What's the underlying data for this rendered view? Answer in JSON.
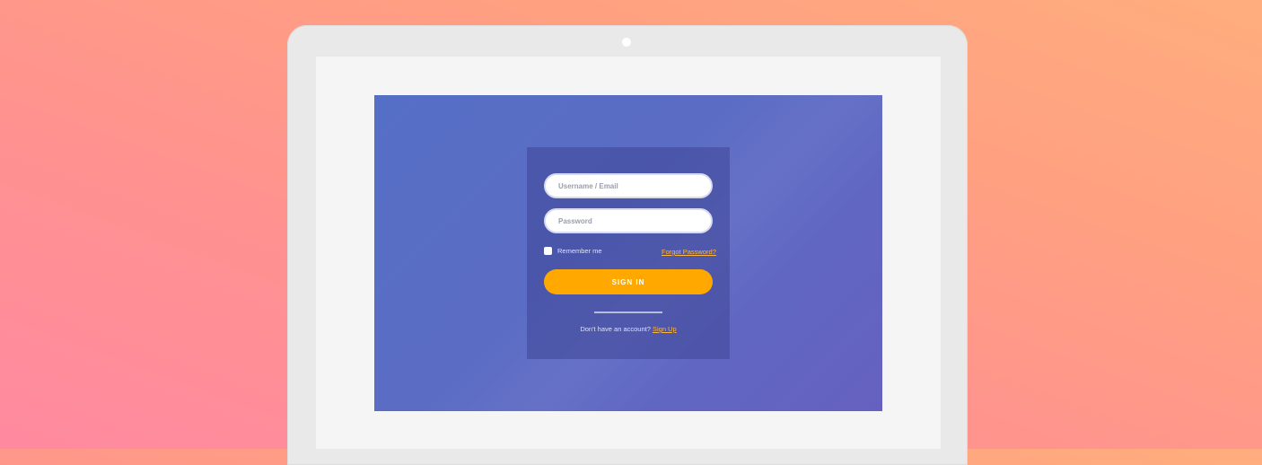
{
  "login": {
    "username_placeholder": "Username / Email",
    "password_placeholder": "Password",
    "remember_label": "Remember me",
    "forgot_link": "Forgot Password?",
    "signin_label": "SIGN IN",
    "no_account_text": "Don't have an account?",
    "signup_link": "Sign Up"
  },
  "colors": {
    "background_gradient_start": "#ff8aa0",
    "background_gradient_end": "#ffad7e",
    "app_gradient_start": "#566fc6",
    "app_gradient_end": "#6661c0",
    "accent": "#ffa900",
    "link": "#ffb63a"
  }
}
